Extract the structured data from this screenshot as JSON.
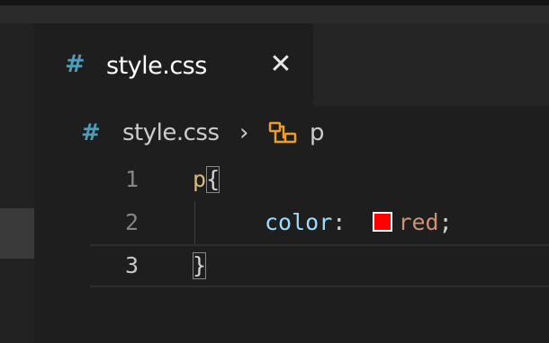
{
  "tab": {
    "icon": "#",
    "label": "style.css",
    "close": "✕"
  },
  "breadcrumb": {
    "icon": "#",
    "file": "style.css",
    "separator": "›",
    "symbol_icon": "css-selector-icon",
    "symbol": "p"
  },
  "editor": {
    "lines": [
      {
        "number": "1",
        "selector": "p",
        "brace": "{"
      },
      {
        "number": "2",
        "property": "color",
        "colon": ":",
        "swatch_color": "#ff0000",
        "value": "red",
        "semicolon": ";"
      },
      {
        "number": "3",
        "brace": "}"
      }
    ]
  }
}
